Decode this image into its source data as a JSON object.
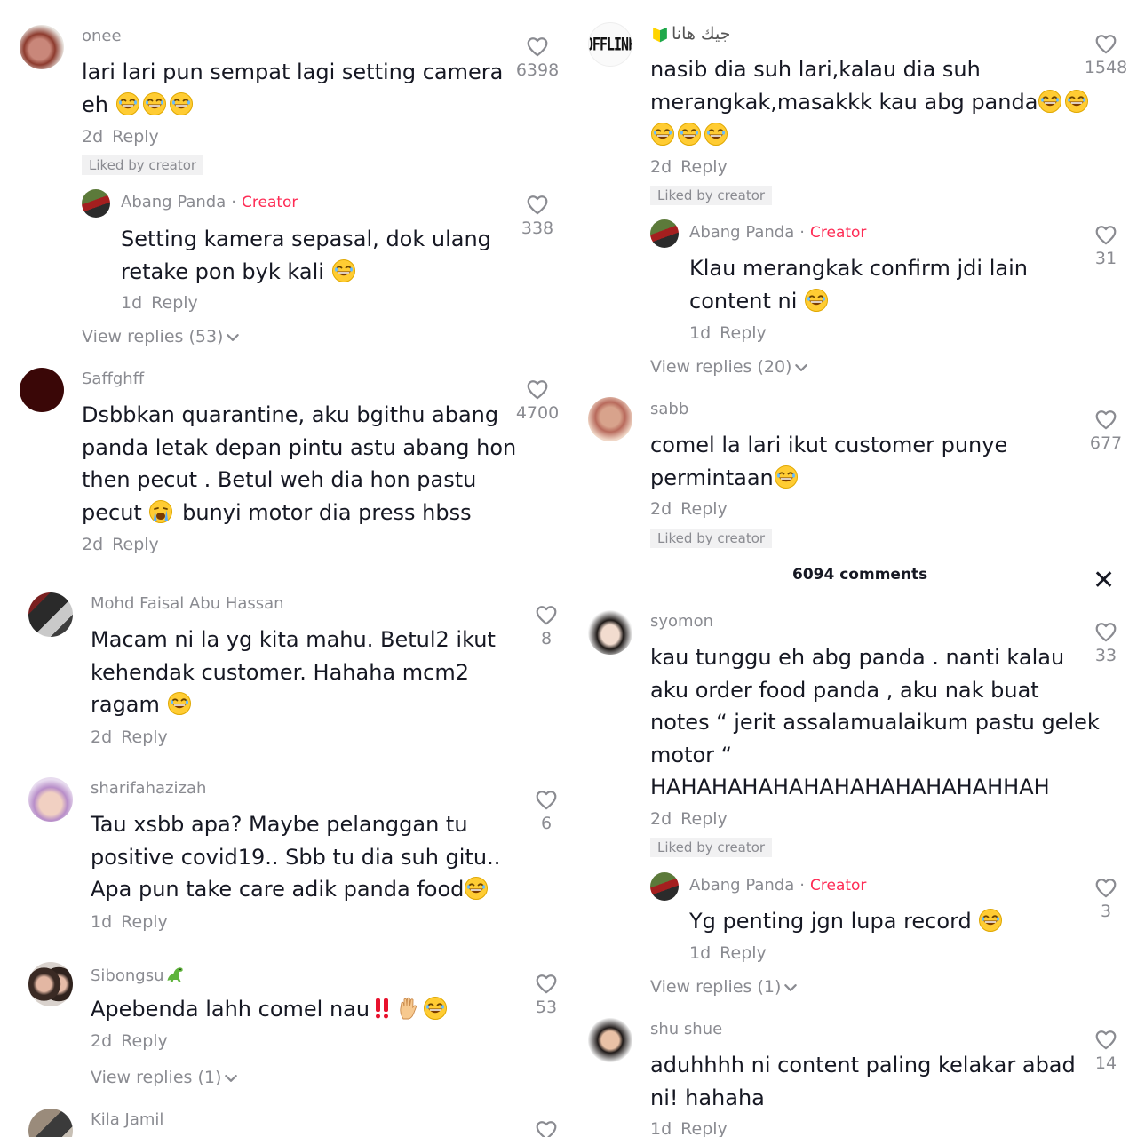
{
  "panel1": {
    "c1": {
      "user": "onee",
      "line1": "lari lari pun sempat lagi setting camera",
      "line2": "eh",
      "time": "2d",
      "reply": "Reply",
      "liked": "Liked by creator",
      "likes": "6398"
    },
    "r1": {
      "user": "Abang Panda",
      "creator": "Creator",
      "line1": "Setting kamera sepasal, dok ulang",
      "line2": "retake pon byk kali",
      "time": "1d",
      "reply": "Reply",
      "likes": "338"
    },
    "view_replies": "View replies (53)",
    "c2": {
      "user": "Saffghff",
      "line1": "Dsbbkan quarantine, aku bgithu abang",
      "line2": "panda letak depan pintu astu abang hon",
      "line3": "then pecut . Betul weh dia hon pastu",
      "line4a": "pecut",
      "line4b": "bunyi motor dia press hbss",
      "time": "2d",
      "reply": "Reply",
      "likes": "4700"
    }
  },
  "panel2": {
    "c1": {
      "badge": "OFFLINE",
      "user": "جيك هانا",
      "line1": "nasib dia suh lari,kalau dia suh",
      "line2": "merangkak,masakkk kau abg panda",
      "time": "2d",
      "reply": "Reply",
      "liked": "Liked by creator",
      "likes": "1548"
    },
    "r1": {
      "user": "Abang Panda",
      "creator": "Creator",
      "line1": "Klau merangkak confirm jdi lain",
      "line2": "content ni",
      "time": "1d",
      "reply": "Reply",
      "likes": "31"
    },
    "view_replies": "View replies (20)",
    "c2": {
      "user": "sabb",
      "line1": "comel la lari ikut customer punye",
      "line2": "permintaan",
      "time": "2d",
      "reply": "Reply",
      "liked": "Liked by creator",
      "likes": "677"
    }
  },
  "panel3": {
    "c1": {
      "user": "Mohd Faisal Abu Hassan",
      "line1": "Macam ni la yg kita mahu. Betul2 ikut",
      "line2": "kehendak customer. Hahaha mcm2",
      "line3": "ragam",
      "time": "2d",
      "reply": "Reply",
      "likes": "8"
    },
    "c2": {
      "user": "sharifahazizah",
      "line1": "Tau xsbb apa? Maybe pelanggan tu",
      "line2": "positive covid19.. Sbb tu dia suh gitu..",
      "line3": "Apa pun take care adik panda food",
      "time": "1d",
      "reply": "Reply",
      "likes": "6"
    },
    "c3": {
      "user": "Sibongsu",
      "line1": "Apebenda lahh comel nau",
      "time": "2d",
      "reply": "Reply",
      "likes": "53"
    },
    "view_replies": "View replies (1)",
    "c4": {
      "user": "Kila Jamil"
    }
  },
  "panel4": {
    "header": {
      "title": "6094 comments",
      "close": "✕"
    },
    "c1": {
      "user": "syomon",
      "line1": "kau tunggu eh abg panda . nanti kalau",
      "line2": "aku order food panda , aku nak buat",
      "line3": "notes “ jerit assalamualaikum pastu gelek",
      "line4": "motor “",
      "line5": "HAHAHAHAHAHAHAHAHAHAHAHHAH",
      "time": "2d",
      "reply": "Reply",
      "liked": "Liked by creator",
      "likes": "33"
    },
    "r1": {
      "user": "Abang Panda",
      "creator": "Creator",
      "line1": "Yg penting jgn lupa record",
      "time": "1d",
      "reply": "Reply",
      "likes": "3"
    },
    "view_replies": "View replies (1)",
    "c2": {
      "user": "shu shue",
      "line1": "aduhhhh ni content paling kelakar abad",
      "line2": "ni! hahaha",
      "time": "1d",
      "reply": "Reply",
      "likes": "14"
    }
  },
  "colors": {
    "creator": "#fe2c55",
    "muted": "#8a8b91",
    "text": "#161823",
    "liked_bg": "#f1f1f2"
  },
  "icons": [
    "heart-icon",
    "chevron-down-icon",
    "laughing-emoji",
    "crying-emoji",
    "double-exclamation-emoji",
    "raised-hand-emoji",
    "dinosaur-emoji",
    "beginner-badge-emoji",
    "close-icon"
  ]
}
